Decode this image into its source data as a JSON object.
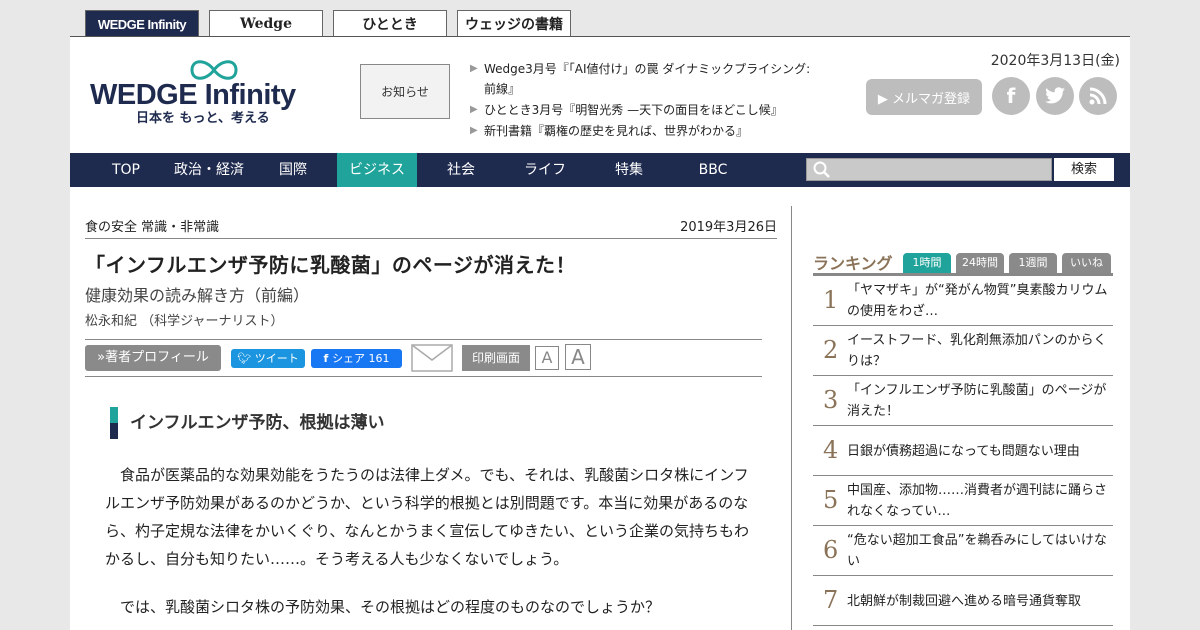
{
  "site_tabs": [
    "WEDGE Infinity",
    "Wedge",
    "ひととき",
    "ウェッジの書籍"
  ],
  "logo": {
    "name": "WEDGE Infinity",
    "tagline": "日本を もっと、考える"
  },
  "notice_label": "お知らせ",
  "news": [
    "Wedge3月号『「AI値付け」の罠 ダイナミックプライシング: 前線』",
    "ひととき3月号『明智光秀 —天下の面目をほどこし候』",
    "新刊書籍『覇権の歴史を見れば、世界がわかる』"
  ],
  "header_date": "2020年3月13日(金)",
  "mail_magazine_label": "▶ メルマガ登録",
  "nav": [
    "TOP",
    "政治・経済",
    "国際",
    "ビジネス",
    "社会",
    "ライフ",
    "特集",
    "BBC"
  ],
  "nav_active": "ビジネス",
  "search": {
    "placeholder": "",
    "button": "検索"
  },
  "article": {
    "category": "食の安全 常識・非常識",
    "date": "2019年3月26日",
    "title": "「インフルエンザ予防に乳酸菌」のページが消えた！",
    "subtitle": "健康効果の読み解き方（前編）",
    "author": "松永和紀 （科学ジャーナリスト）",
    "profile_button": "»著者プロフィール",
    "tweet_label": "ツイート",
    "fb_label": "シェア 161",
    "print_label": "印刷画面",
    "font_small": "A",
    "font_large": "A",
    "section_heading": "インフルエンザ予防、根拠は薄い",
    "paragraphs": [
      "食品が医薬品的な効果効能をうたうのは法律上ダメ。でも、それは、乳酸菌シロタ株にインフルエンザ予防効果があるのかどうか、という科学的根拠とは別問題です。本当に効果があるのなら、杓子定規な法律をかいくぐり、なんとかうまく宣伝してゆきたい、という企業の気持ちもわかるし、自分も知りたい……。そう考える人も少なくないでしょう。",
      "では、乳酸菌シロタ株の予防効果、その根拠はどの程度のものなのでしょうか？"
    ]
  },
  "ranking": {
    "title": "ランキング",
    "tabs": [
      "1時間",
      "24時間",
      "1週間",
      "いいね"
    ],
    "active_tab": "1時間",
    "items": [
      {
        "num": "1",
        "text": "「ヤマザキ」が“発がん物質”臭素酸カリウムの使用をわざ…"
      },
      {
        "num": "2",
        "text": "イーストフード、乳化剤無添加パンのからくりは？"
      },
      {
        "num": "3",
        "text": "「インフルエンザ予防に乳酸菌」のページが消えた！"
      },
      {
        "num": "4",
        "text": "日銀が債務超過になっても問題ない理由"
      },
      {
        "num": "5",
        "text": "中国産、添加物……消費者が週刊誌に踊らされなくなってい…"
      },
      {
        "num": "6",
        "text": "“危ない超加工食品”を鵜呑みにしてはいけない"
      },
      {
        "num": "7",
        "text": "北朝鮮が制裁回避へ進める暗号通貨奪取"
      }
    ]
  },
  "colors": {
    "navy": "#1e2a4e",
    "teal": "#1fa39a",
    "gray": "#8a8a8a",
    "rank_brown": "#8a7358"
  }
}
